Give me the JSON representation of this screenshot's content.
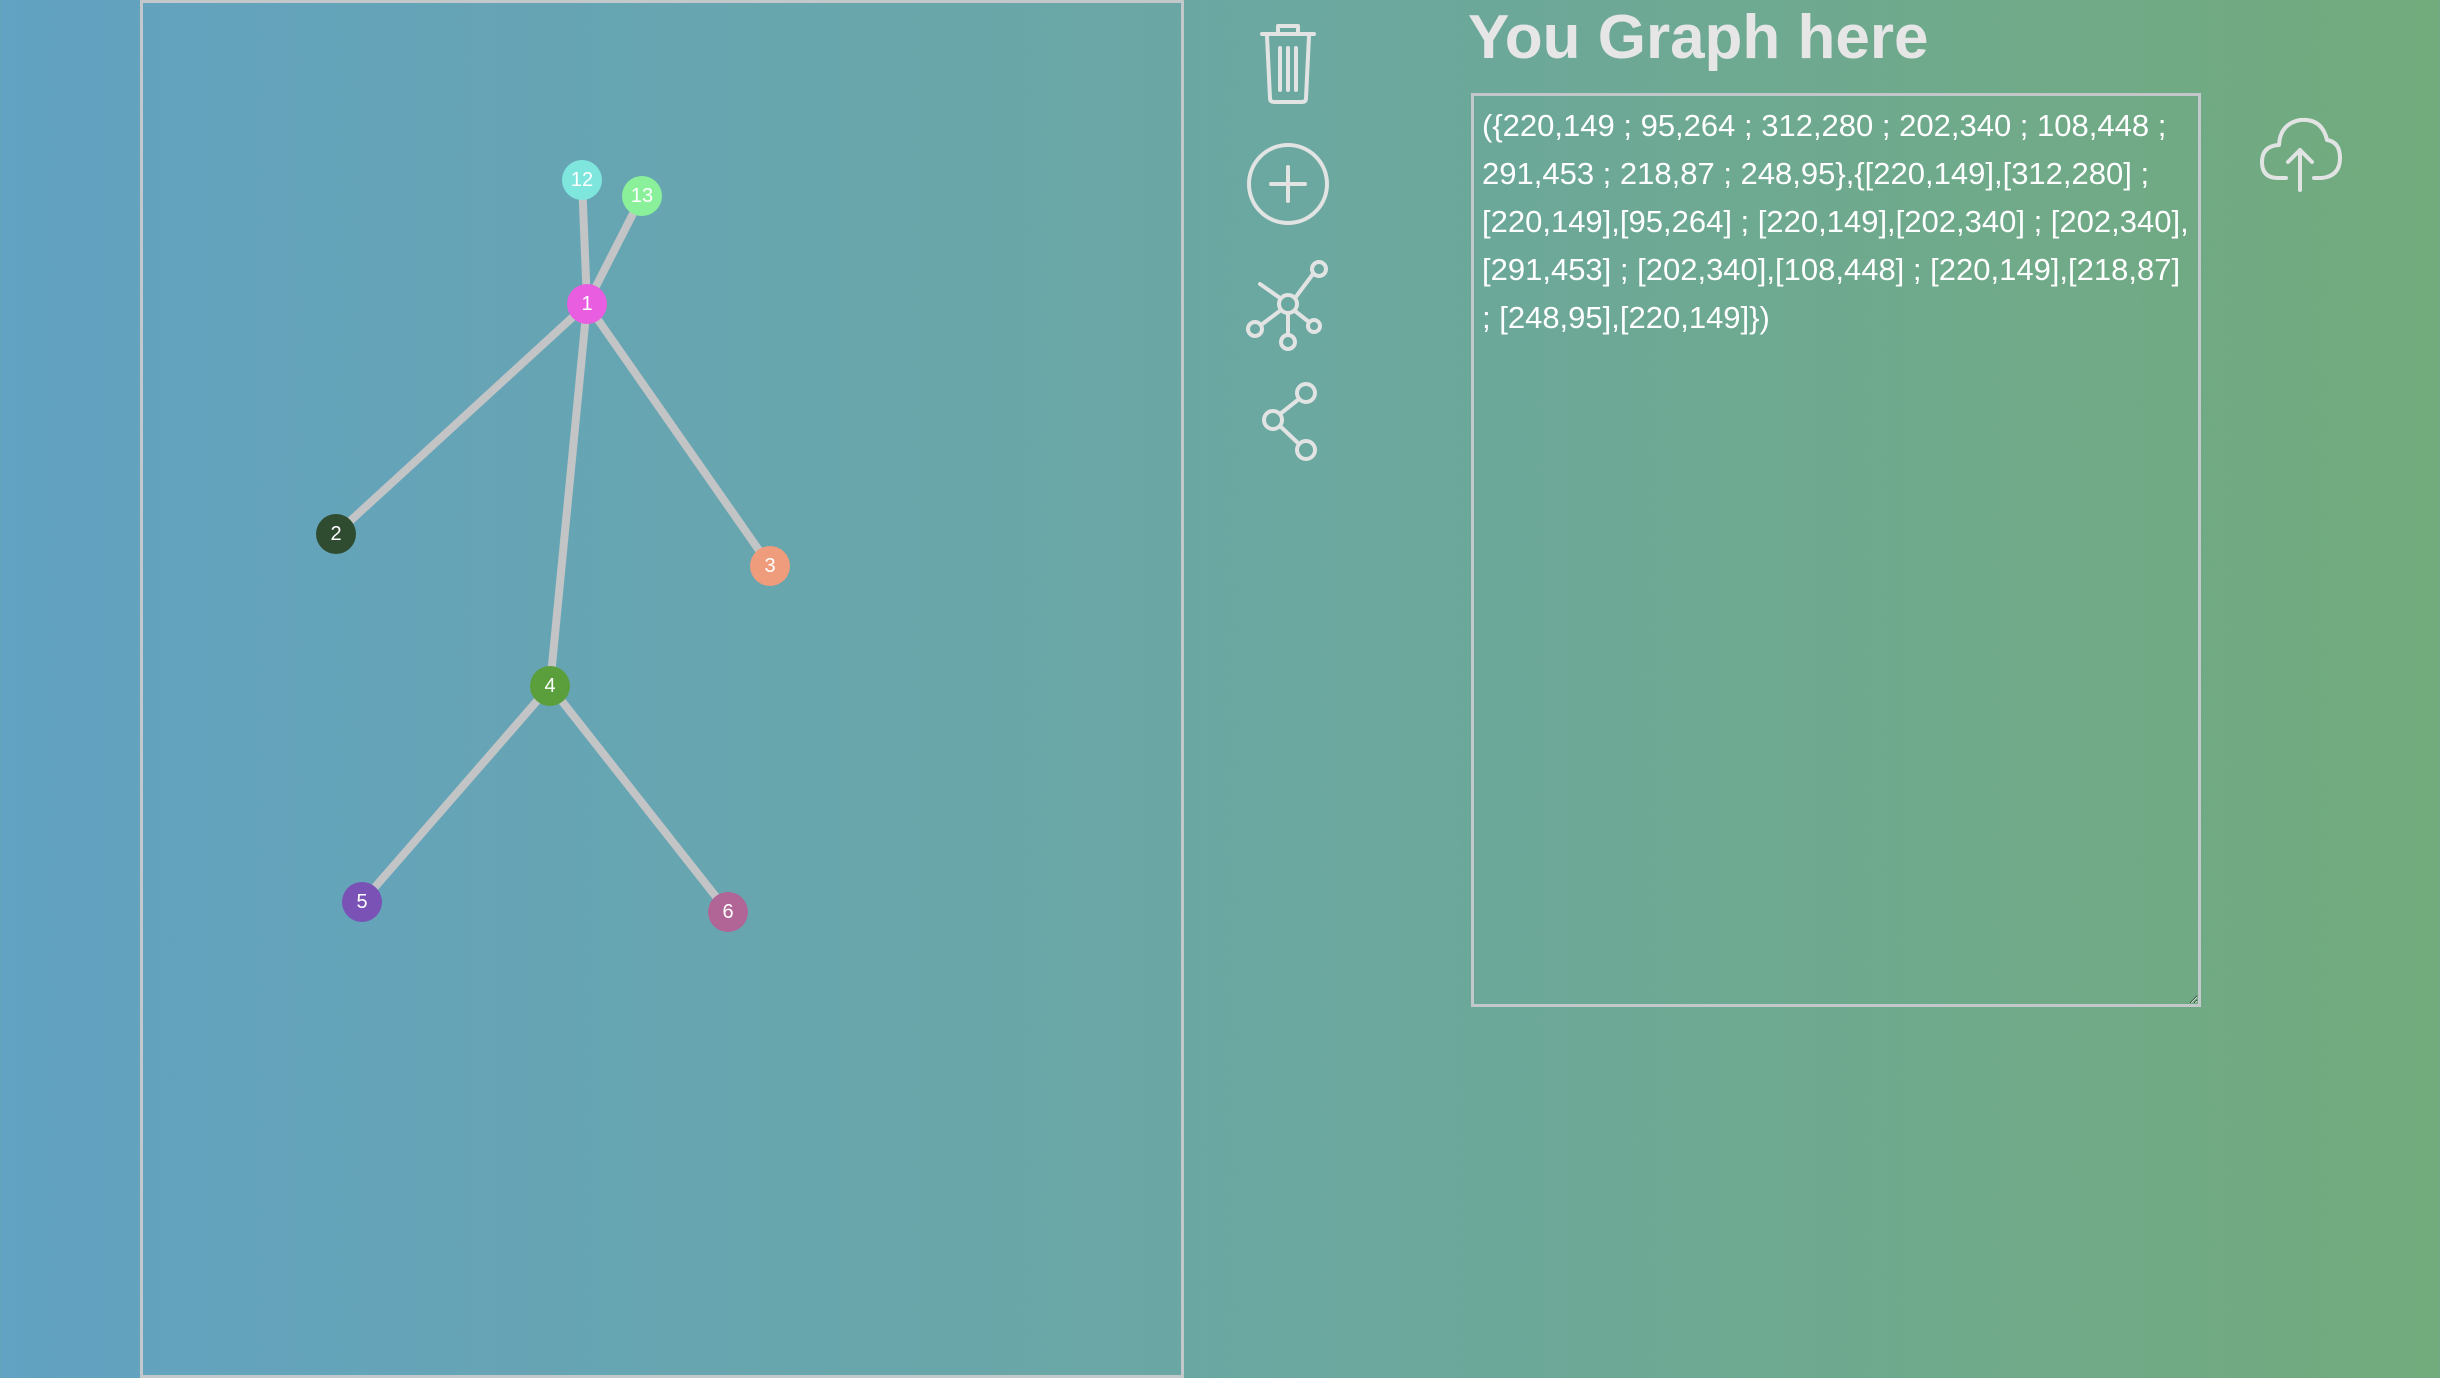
{
  "graph": {
    "edge_color": "#c2c4c6",
    "nodes": [
      {
        "id": "1",
        "label": "1",
        "color": "#e95ee0"
      },
      {
        "id": "2",
        "label": "2",
        "color": "#2f4b30"
      },
      {
        "id": "3",
        "label": "3",
        "color": "#ee9c7c"
      },
      {
        "id": "4",
        "label": "4",
        "color": "#5b9f3d"
      },
      {
        "id": "5",
        "label": "5",
        "color": "#7a51b5"
      },
      {
        "id": "6",
        "label": "6",
        "color": "#b06596"
      },
      {
        "id": "12",
        "label": "12",
        "color": "#7fe6de"
      },
      {
        "id": "13",
        "label": "13",
        "color": "#8af09a"
      }
    ],
    "edges": [
      [
        "1",
        "2"
      ],
      [
        "1",
        "3"
      ],
      [
        "1",
        "4"
      ],
      [
        "4",
        "5"
      ],
      [
        "4",
        "6"
      ],
      [
        "1",
        "12"
      ],
      [
        "1",
        "13"
      ]
    ]
  },
  "toolbar": {
    "icons": [
      "trash-icon",
      "add-circle-icon",
      "network-icon",
      "share-icon"
    ]
  },
  "panel": {
    "title": "You Graph here",
    "graph_text": "({220,149 ; 95,264 ; 312,280 ; 202,340 ; 108,448 ; 291,453 ; 218,87 ; 248,95},{[220,149],[312,280] ; [220,149],[95,264] ; [220,149],[202,340] ; [202,340],[291,453] ; [202,340],[108,448] ; [220,149],[218,87] ; [248,95],[220,149]})",
    "upload_icon": "cloud-upload-icon"
  }
}
